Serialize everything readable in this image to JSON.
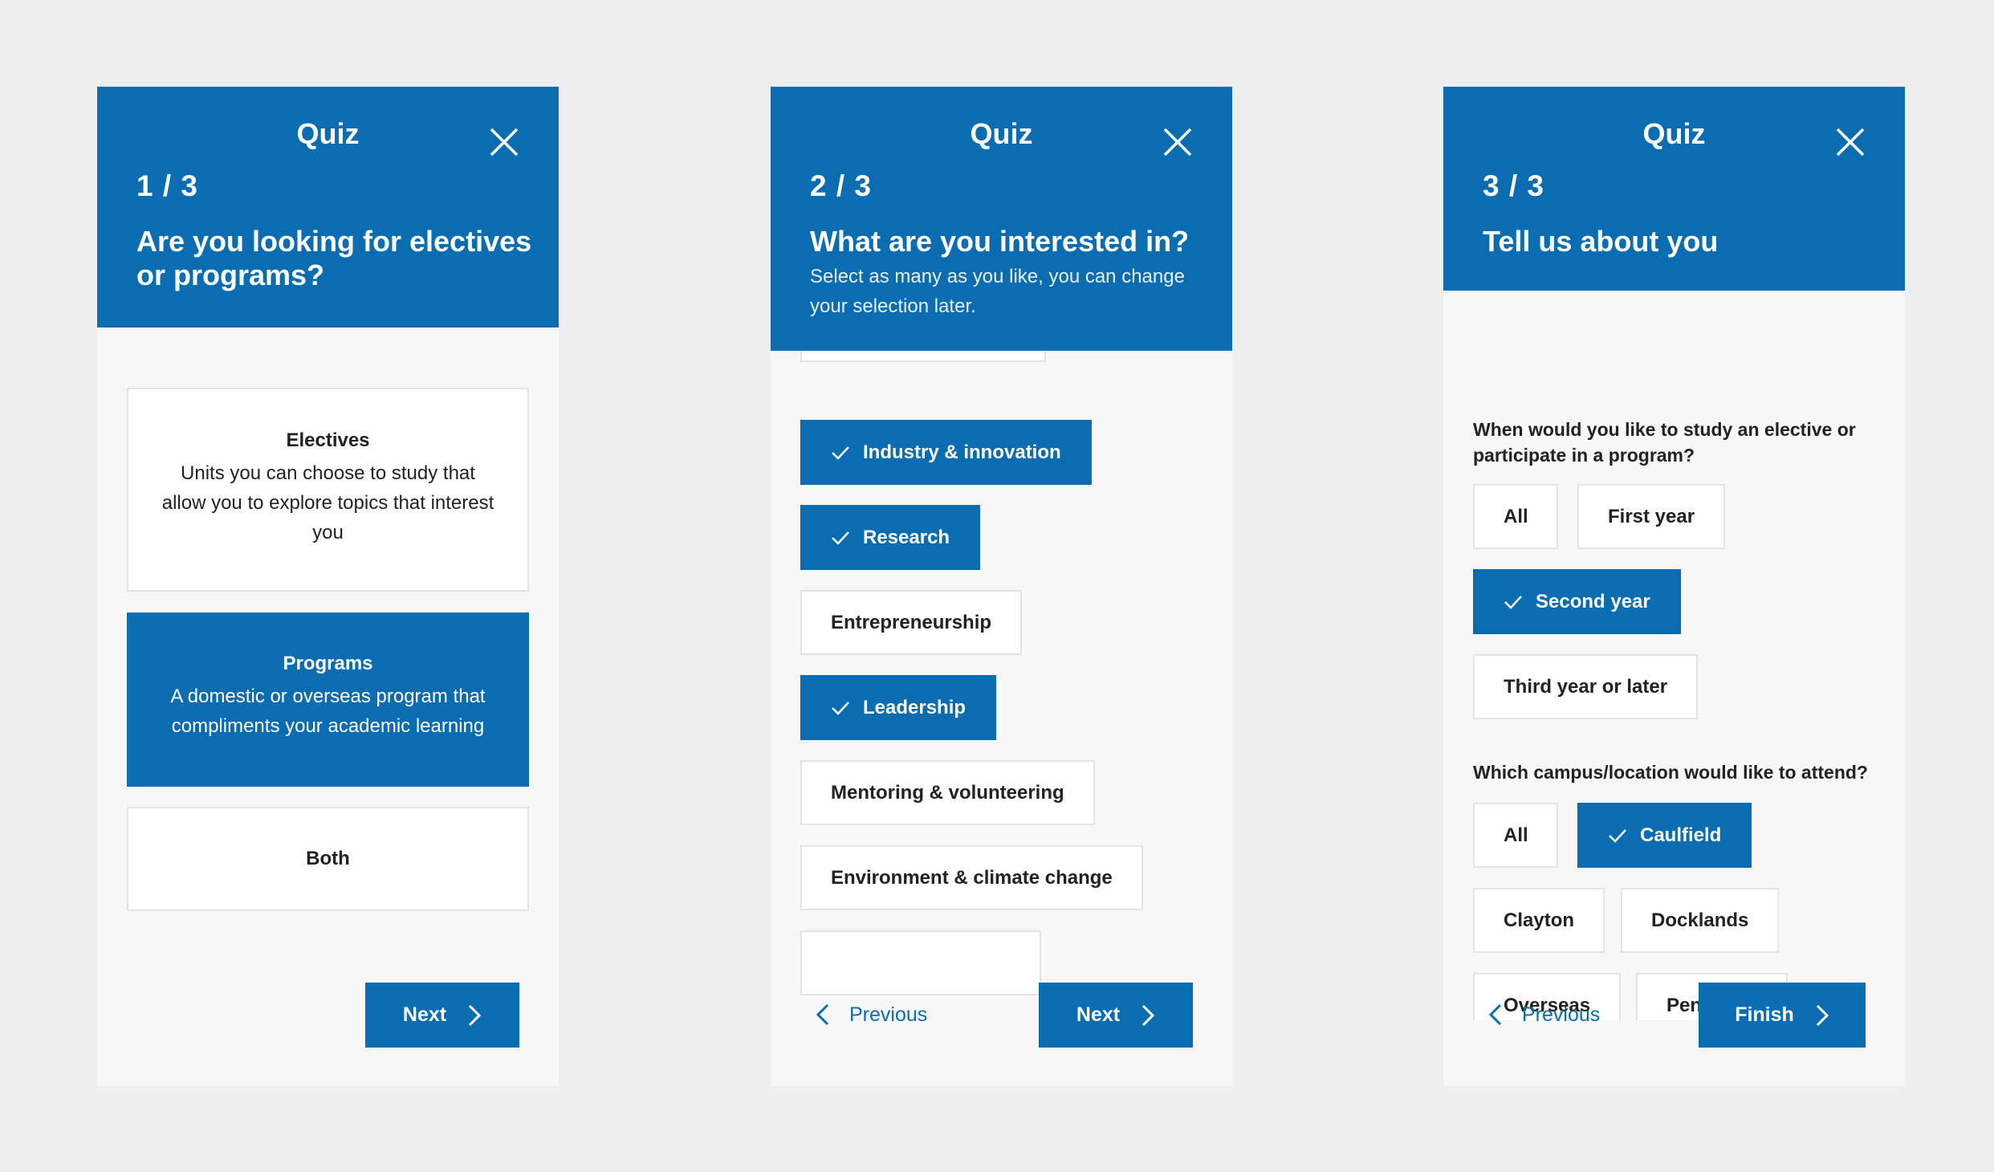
{
  "colors": {
    "accent": "#0a6cb1",
    "background": "#eeeeee",
    "panel": "#f7f7f7"
  },
  "panels": [
    {
      "title": "Quiz",
      "step": "1 / 3",
      "question": "Are you looking for electives or programs?",
      "options": [
        {
          "title": "Electives",
          "desc": "Units you can choose to study that allow you to explore topics that interest you",
          "selected": false
        },
        {
          "title": "Programs",
          "desc": "A domestic or overseas program that compliments your academic learning",
          "selected": true
        },
        {
          "title": "Both",
          "selected": false
        }
      ],
      "next_label": "Next"
    },
    {
      "title": "Quiz",
      "step": "2 / 3",
      "question": "What are you interested in?",
      "subtitle": "Select as many as you like, you can change your selection later.",
      "options": [
        {
          "label": "Industry & innovation",
          "selected": true
        },
        {
          "label": "Research",
          "selected": true
        },
        {
          "label": "Entrepreneurship",
          "selected": false
        },
        {
          "label": "Leadership",
          "selected": true
        },
        {
          "label": "Mentoring & volunteering",
          "selected": false
        },
        {
          "label": "Environment & climate change",
          "selected": false
        }
      ],
      "previous_label": "Previous",
      "next_label": "Next"
    },
    {
      "title": "Quiz",
      "step": "3 / 3",
      "question": "Tell us about you",
      "q1": "When would you like to study an elective or participate in a program?",
      "q1_options": [
        {
          "label": "All",
          "selected": false
        },
        {
          "label": "First year",
          "selected": false
        },
        {
          "label": "Second year",
          "selected": true
        },
        {
          "label": "Third year or later",
          "selected": false
        }
      ],
      "q2": "Which campus/location would like to attend?",
      "q2_options": [
        {
          "label": "All",
          "selected": false
        },
        {
          "label": "Caulfield",
          "selected": true
        },
        {
          "label": "Clayton",
          "selected": false
        },
        {
          "label": "Docklands",
          "selected": false
        },
        {
          "label": "Overseas",
          "selected": false
        },
        {
          "label": "Peninsula",
          "selected": false
        }
      ],
      "previous_label": "Previous",
      "finish_label": "Finish"
    }
  ]
}
